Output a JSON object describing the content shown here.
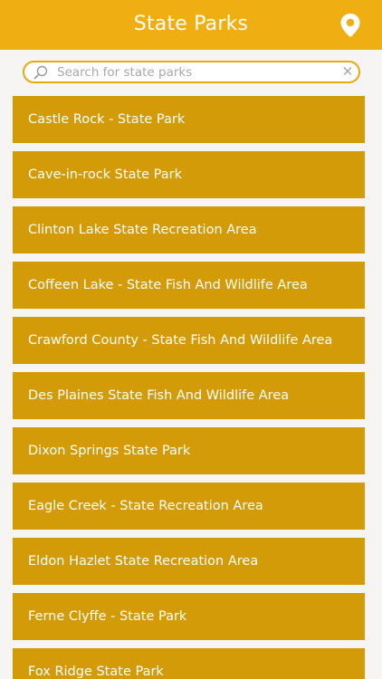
{
  "app": {
    "title": "State Parks",
    "accent_color": "#efaf13",
    "item_color": "#d49b09"
  },
  "header": {
    "location_icon": "map-pin-icon"
  },
  "search": {
    "placeholder": "Search for state parks",
    "value": "",
    "search_icon": "magnifier-icon",
    "clear_icon": "clear-x-icon",
    "clear_glyph": "✕"
  },
  "parks": [
    {
      "label": "Castle Rock - State Park"
    },
    {
      "label": "Cave-in-rock State Park"
    },
    {
      "label": "Clinton Lake State Recreation Area"
    },
    {
      "label": "Coffeen Lake - State Fish And Wildlife Area"
    },
    {
      "label": "Crawford County - State Fish And Wildlife Area"
    },
    {
      "label": "Des Plaines State Fish And Wildlife Area"
    },
    {
      "label": "Dixon Springs State Park"
    },
    {
      "label": "Eagle Creek - State Recreation Area"
    },
    {
      "label": "Eldon Hazlet State Recreation Area"
    },
    {
      "label": "Ferne Clyffe - State Park"
    },
    {
      "label": "Fox Ridge State Park"
    }
  ]
}
